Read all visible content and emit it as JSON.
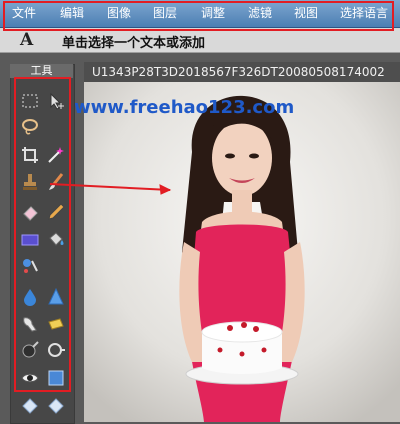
{
  "menubar": {
    "items": [
      "文件",
      "编辑",
      "图像",
      "图层",
      "调整",
      "滤镜",
      "视图",
      "选择语言"
    ]
  },
  "options_bar": {
    "tool_icon_glyph": "A",
    "hint": "单击选择一个文本或添加"
  },
  "tools_panel": {
    "title": "工具",
    "tools": [
      {
        "name": "marquee-tool-icon"
      },
      {
        "name": "move-tool-icon"
      },
      {
        "name": "lasso-tool-icon"
      },
      {
        "name": "crop-tool-icon"
      },
      {
        "name": "magic-wand-tool-icon"
      },
      {
        "name": "stamp-tool-icon"
      },
      {
        "name": "brush-tool-icon"
      },
      {
        "name": "eraser-tool-icon"
      },
      {
        "name": "pencil-tool-icon"
      },
      {
        "name": "rectangle-tool-icon"
      },
      {
        "name": "bucket-tool-icon"
      },
      {
        "name": "replace-color-tool-icon"
      },
      {
        "name": "drop-tool-icon"
      },
      {
        "name": "sharpen-tool-icon"
      },
      {
        "name": "smudge-tool-icon"
      },
      {
        "name": "sponge-tool-icon"
      },
      {
        "name": "burn-tool-icon"
      },
      {
        "name": "dodge-tool-icon"
      },
      {
        "name": "eye-tool-icon"
      },
      {
        "name": "hand-tool-icon"
      },
      {
        "name": "zoom-out-tool-icon"
      },
      {
        "name": "zoom-in-tool-icon"
      }
    ]
  },
  "document": {
    "title": "U1343P28T3D2018567F326DT20080508174002",
    "watermark": "www.freehao123.com"
  },
  "colors": {
    "menubar": "#5b8cc0",
    "highlight": "#e21d23",
    "watermark": "#1f59c8",
    "dress": "#e2245a"
  }
}
